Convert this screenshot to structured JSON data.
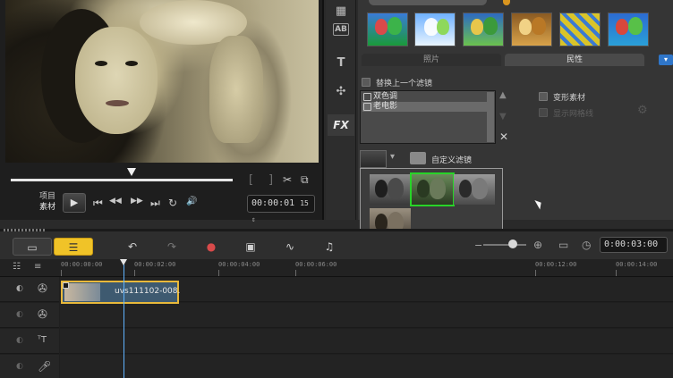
{
  "preview": {
    "mode_project": "项目",
    "mode_clip": "素材",
    "timecode": "00:00:01",
    "timecode_frames": "15",
    "transport_icons": [
      "⏮",
      "◀◀",
      "▶▶",
      "⏭",
      "↻",
      "🔊"
    ]
  },
  "side_tools": {
    "title_icon": "T",
    "text_icon": "AB",
    "fx_label": "FX"
  },
  "library": {
    "tab_photo": "照片",
    "tab_folk": "民性",
    "collapse_icon": "chevron-down-icon",
    "replace_last_filter": "替换上一个滤镜",
    "filters": [
      "双色调",
      "老电影"
    ],
    "transform_clip": "变形素材",
    "show_grid": "显示网格线",
    "custom_filter": "自定义滤镜"
  },
  "timeline": {
    "timecode": "0:00:03:00",
    "ruler_labels": [
      "00:00:00:00",
      "00:00:02:00",
      "00:00:04:00",
      "00:00:06:00",
      "00:00:12:00",
      "00:00:14:00"
    ],
    "clip_label": "uvs111102-008."
  },
  "colors": {
    "accent": "#f0c328",
    "selection": "#28d428",
    "clip_border": "#e8b83a",
    "playhead": "#5fb3ff"
  }
}
